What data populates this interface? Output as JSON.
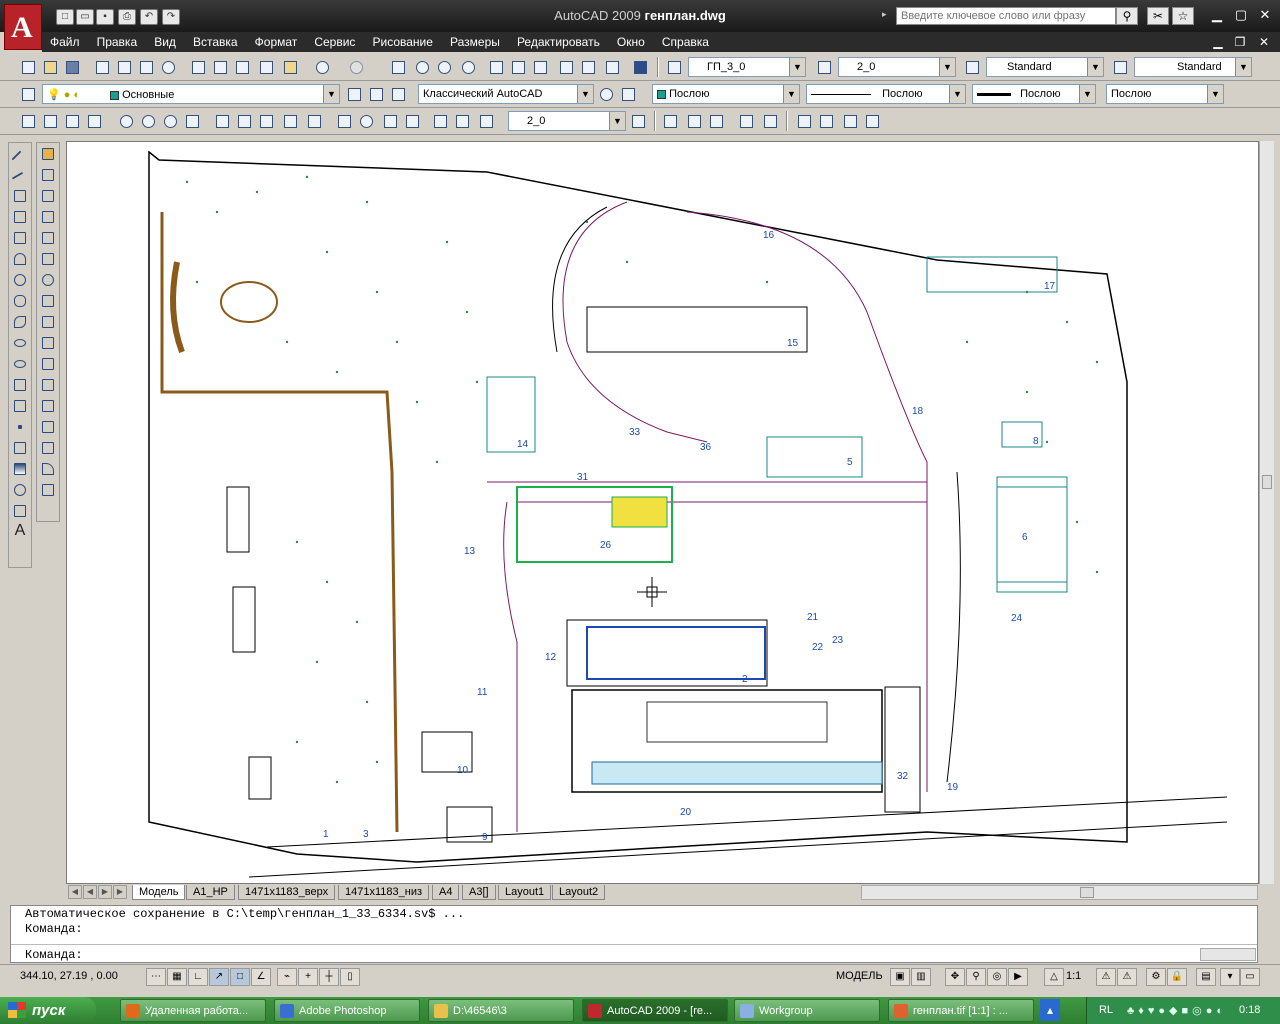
{
  "window": {
    "app_title": "AutoCAD 2009",
    "document_title": "генплан.dwg",
    "search_placeholder": "Введите ключевое слово или фразу"
  },
  "menu": [
    "Файл",
    "Правка",
    "Вид",
    "Вставка",
    "Формат",
    "Сервис",
    "Рисование",
    "Размеры",
    "Редактировать",
    "Окно",
    "Справка"
  ],
  "toolbars": {
    "text_style": "ГП_3_0",
    "dim_scale": "2_0",
    "table_style": "Standard",
    "multileader_style": "Standard",
    "layer": "Основные",
    "workspace": "Классический AutoCAD",
    "color": "Послою",
    "linetype": "Послою",
    "lineweight": "Послою",
    "plot_style": "Послою",
    "dim_style": "2_0"
  },
  "layout_tabs": [
    "Модель",
    "A1_HP",
    "1471x1183_верх",
    "1471x1183_низ",
    "A4",
    "A3[]",
    "Layout1",
    "Layout2"
  ],
  "command": {
    "line1": "Автоматическое сохранение в C:\\temp\\генплан_1_33_6334.sv$ ...",
    "line2": "Команда:",
    "prompt": "Команда:"
  },
  "status": {
    "coordinates": "344.10, 27.19 , 0.00",
    "space": "МОДЕЛЬ",
    "annotation_scale": "1:1"
  },
  "taskbar": {
    "start": "пуск",
    "tasks": [
      {
        "label": "Удаленная работа...",
        "icon_color": "#e06a1b"
      },
      {
        "label": "Adobe Photoshop",
        "icon_color": "#3a6fcf"
      },
      {
        "label": "D:\\46546\\3",
        "icon_color": "#e8c04a"
      },
      {
        "label": "AutoCAD 2009 - [re...",
        "icon_color": "#c0282e"
      },
      {
        "label": "Workgroup",
        "icon_color": "#8ab0e0"
      },
      {
        "label": "генплан.tif [1:1] : ...",
        "icon_color": "#e06030"
      }
    ],
    "lang": "RL",
    "clock": "0:18"
  },
  "plan_labels": [
    "1",
    "2",
    "3",
    "5",
    "6",
    "8",
    "9",
    "10",
    "11",
    "12",
    "13",
    "14",
    "15",
    "16",
    "17",
    "18",
    "19",
    "20",
    "21",
    "22",
    "23",
    "24",
    "26",
    "31",
    "32",
    "33",
    "36"
  ],
  "colors": {
    "title_bar": "#1f1f1f",
    "menu_bar": "#2b2b2b",
    "logo": "#b8232a",
    "taskbar": "#3a8f3c",
    "canvas": "#ffffff"
  }
}
